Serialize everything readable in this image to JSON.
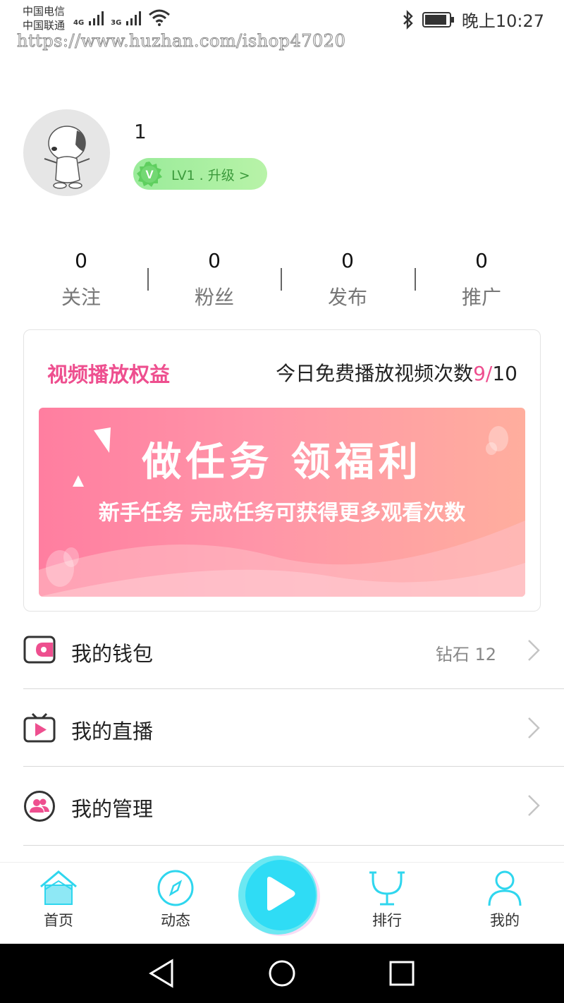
{
  "status_bar": {
    "carrier_1": "中国电信",
    "carrier_2": "中国联通",
    "net_1": "4G",
    "net_2": "3G",
    "time": "晚上10:27"
  },
  "watermark": "https://www.huzhan.com/ishop47020",
  "profile": {
    "username": "1",
    "level_badge_icon": "V",
    "level_text": "LV1 . 升级 >"
  },
  "stats": [
    {
      "value": "0",
      "label": "关注"
    },
    {
      "value": "0",
      "label": "粉丝"
    },
    {
      "value": "0",
      "label": "发布"
    },
    {
      "value": "0",
      "label": "推广"
    }
  ],
  "video_rights": {
    "title": "视频播放权益",
    "quota_label": "今日免费播放视频次数",
    "quota_used": "9",
    "quota_total": "10",
    "banner_headline": "做任务  领福利",
    "banner_subtitle": "新手任务   完成任务可获得更多观看次数"
  },
  "menu": [
    {
      "label": "我的钱包",
      "value": "钻石 12",
      "icon": "wallet-icon"
    },
    {
      "label": "我的直播",
      "value": "",
      "icon": "live-tv-icon"
    },
    {
      "label": "我的管理",
      "value": "",
      "icon": "manage-users-icon"
    }
  ],
  "tabs": [
    {
      "label": "首页",
      "icon": "home-icon",
      "active": true
    },
    {
      "label": "动态",
      "icon": "compass-icon",
      "active": false
    },
    {
      "label": "",
      "icon": "play-icon",
      "active": false
    },
    {
      "label": "排行",
      "icon": "trophy-icon",
      "active": false
    },
    {
      "label": "我的",
      "icon": "user-icon",
      "active": false
    }
  ],
  "colors": {
    "accent_pink": "#ee4f8f",
    "accent_cyan": "#2fd6ee",
    "level_green": "#9aeb9a"
  }
}
